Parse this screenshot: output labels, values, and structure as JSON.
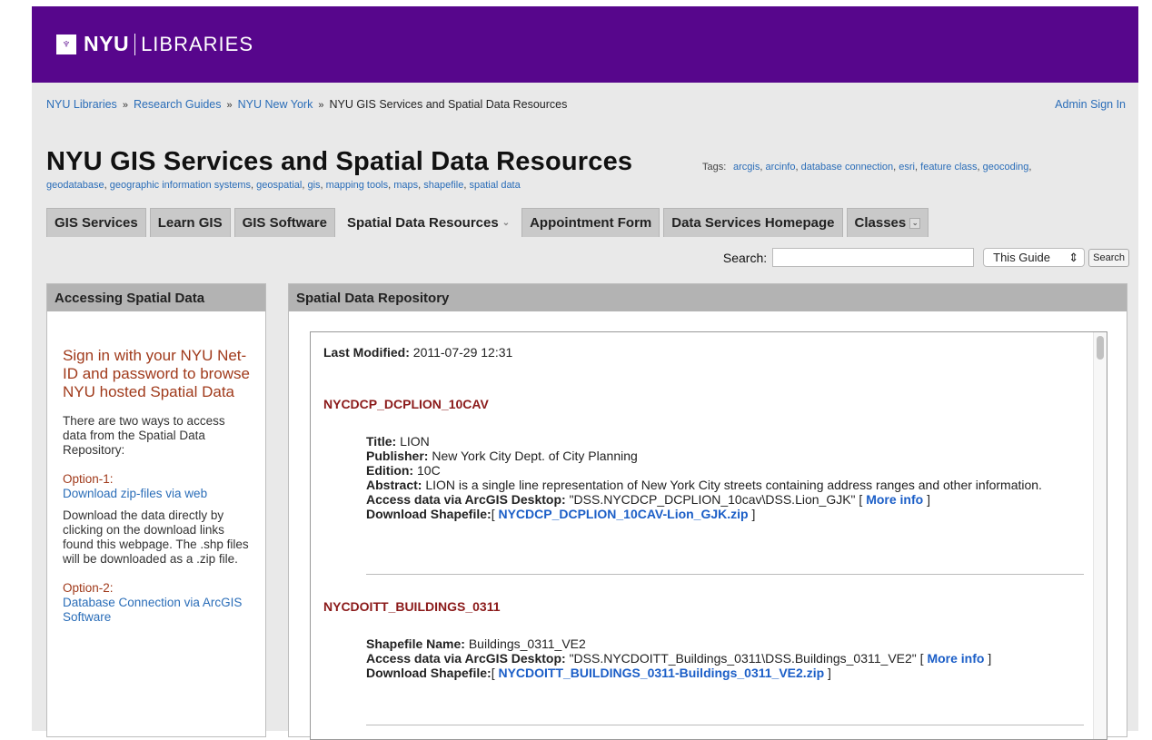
{
  "header": {
    "logo_nyu": "NYU",
    "logo_libraries": "LIBRARIES"
  },
  "breadcrumb": {
    "items": [
      "NYU Libraries",
      "Research Guides",
      "NYU New York"
    ],
    "separator": "»",
    "current": "NYU GIS Services and Spatial Data Resources"
  },
  "admin_link": "Admin Sign In",
  "guide_title": "NYU GIS Services and Spatial Data Resources",
  "tags_label": "Tags:",
  "tags": [
    "arcgis",
    "arcinfo",
    "database connection",
    "esri",
    "feature class",
    "geocoding",
    "geodatabase",
    "geographic information systems",
    "geospatial",
    "gis",
    "mapping tools",
    "maps",
    "shapefile",
    "spatial data"
  ],
  "tabs": [
    {
      "label": "GIS Services"
    },
    {
      "label": "Learn GIS"
    },
    {
      "label": "GIS Software"
    },
    {
      "label": "Spatial Data Resources",
      "caret": "⌄"
    },
    {
      "label": "Appointment Form"
    },
    {
      "label": "Data Services Homepage"
    },
    {
      "label": "Classes",
      "caret": "⌄"
    }
  ],
  "search": {
    "label": "Search:",
    "value": "",
    "scope": "This Guide",
    "scope_arrow": "⇕",
    "button": "Search"
  },
  "left_panel": {
    "title": "Accessing Spatial Data",
    "signin_text": "Sign in with your NYU Net-ID and password to browse NYU hosted Spatial Data",
    "intro": "There are two ways to access data from the Spatial Data Repository:",
    "option1_label": "Option-1:",
    "option1_link": "Download zip-files via web",
    "option1_desc": "Download the data directly by clicking on the download links found this webpage. The .shp files will be downloaded as a .zip file.",
    "option2_label": "Option-2:",
    "option2_link": "Database Connection via ArcGIS Software"
  },
  "right_panel": {
    "title": "Spatial Data Repository",
    "last_modified_label": "Last Modified:",
    "last_modified_value": "2011-07-29 12:31",
    "records": [
      {
        "id": "NYCDCP_DCPLION_10CAV",
        "title_label": "Title:",
        "title": "LION",
        "publisher_label": "Publisher:",
        "publisher": "New York City Dept. of City Planning",
        "edition_label": "Edition:",
        "edition": "10C",
        "abstract_label": "Abstract:",
        "abstract": "LION is a single line representation of New York City streets containing address ranges and other information.",
        "access_label": "Access data via ArcGIS Desktop:",
        "access_value": "\"DSS.NYCDCP_DCPLION_10cav\\DSS.Lion_GJK\"",
        "more_info": "More info",
        "download_label": "Download Shapefile:",
        "download_link": "NYCDCP_DCPLION_10CAV-Lion_GJK.zip"
      },
      {
        "id": "NYCDOITT_BUILDINGS_0311",
        "shapefile_label": "Shapefile Name:",
        "shapefile": "Buildings_0311_VE2",
        "access_label": "Access data via ArcGIS Desktop:",
        "access_value": "\"DSS.NYCDOITT_Buildings_0311\\DSS.Buildings_0311_VE2\"",
        "more_info": "More info",
        "download_label": "Download Shapefile:",
        "download_link": "NYCDOITT_BUILDINGS_0311-Buildings_0311_VE2.zip"
      }
    ]
  }
}
